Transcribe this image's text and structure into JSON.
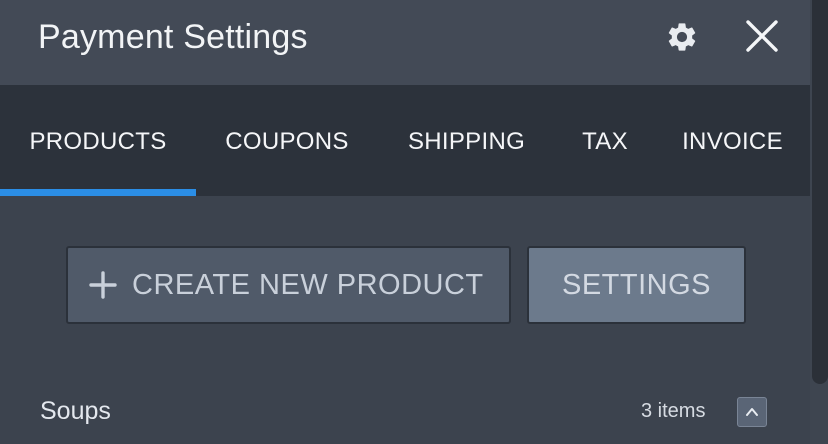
{
  "header": {
    "title": "Payment Settings",
    "gear_icon": "gear-icon",
    "close_icon": "close-icon"
  },
  "tabs": [
    {
      "label": "PRODUCTS",
      "active": true
    },
    {
      "label": "COUPONS",
      "active": false
    },
    {
      "label": "SHIPPING",
      "active": false
    },
    {
      "label": "TAX",
      "active": false
    },
    {
      "label": "INVOICE",
      "active": false
    }
  ],
  "actions": {
    "create_label": "CREATE NEW PRODUCT",
    "create_icon": "plus-icon",
    "settings_label": "SETTINGS"
  },
  "section": {
    "title": "Soups",
    "count": "3 items",
    "collapse_icon": "chevron-up-icon"
  },
  "colors": {
    "accent": "#2b8ee6",
    "header_bg": "#434a56",
    "tabs_bg": "#2c323b",
    "content_bg": "#3c434e"
  }
}
